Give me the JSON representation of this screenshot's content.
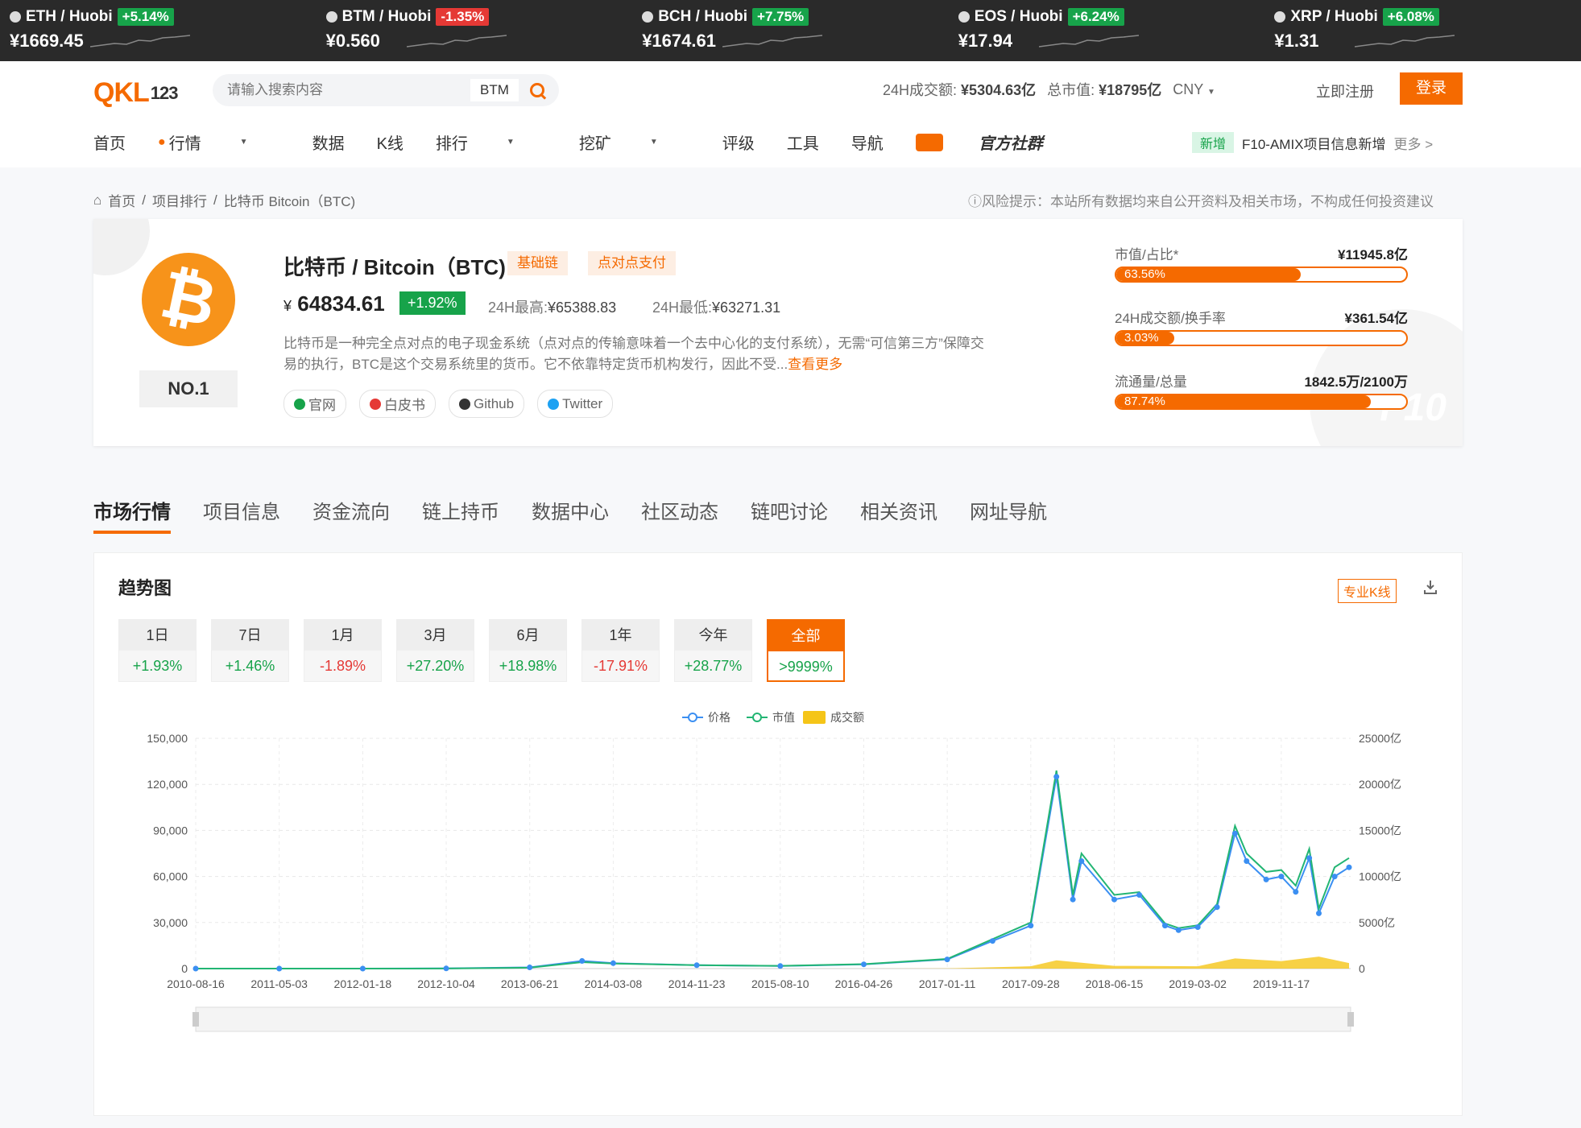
{
  "tickers": [
    {
      "pair": "ETH / Huobi",
      "change": "+5.14%",
      "dir": "up",
      "price": "¥1669.45"
    },
    {
      "pair": "BTM / Huobi",
      "change": "-1.35%",
      "dir": "down",
      "price": "¥0.560"
    },
    {
      "pair": "BCH / Huobi",
      "change": "+7.75%",
      "dir": "up",
      "price": "¥1674.61"
    },
    {
      "pair": "EOS / Huobi",
      "change": "+6.24%",
      "dir": "up",
      "price": "¥17.94"
    },
    {
      "pair": "XRP / Huobi",
      "change": "+6.08%",
      "dir": "up",
      "price": "¥1.31"
    }
  ],
  "header": {
    "logo_main": "QKL",
    "logo_sub": "123",
    "search_placeholder": "请输入搜索内容",
    "search_tag": "BTM",
    "vol_label": "24H成交额:",
    "vol_value": "¥5304.63亿",
    "cap_label": "总市值:",
    "cap_value": "¥18795亿",
    "currency": "CNY",
    "register": "立即注册",
    "login": "登录"
  },
  "nav": {
    "items": [
      "首页",
      "行情",
      "数据",
      "K线",
      "排行",
      "挖矿",
      "评级",
      "工具",
      "导航"
    ],
    "community": "官方社群",
    "news_badge": "新增",
    "news_text": "F10-AMIX项目信息新增",
    "news_more": "更多 >"
  },
  "breadcrumb": {
    "home": "首页",
    "rank": "项目排行",
    "current": "比特币 Bitcoin（BTC)",
    "risk": "ⓘ风险提示：本站所有数据均来自公开资料及相关市场，不构成任何投资建议"
  },
  "coin": {
    "symbol_glyph": "₿",
    "rank": "NO.1",
    "name": "比特币 / Bitcoin（BTC)",
    "tag1": "基础链",
    "tag2": "点对点支付",
    "currency_sign": "¥",
    "price": "64834.61",
    "change": "+1.92%",
    "high_label": "24H最高:",
    "high": "¥65388.83",
    "low_label": "24H最低:",
    "low": "¥63271.31",
    "description": "比特币是一种完全点对点的电子现金系统（点对点的传输意味着一个去中心化的支付系统），无需“可信第三方”保障交易的执行，BTC是这个交易系统里的货币。它不依靠特定货币机构发行，因此不受...",
    "more": "查看更多",
    "links": [
      "官网",
      "白皮书",
      "Github",
      "Twitter"
    ],
    "metrics": [
      {
        "label": "市值/占比*",
        "value": "¥11945.8亿",
        "pct": "63.56%",
        "fill": 0.6356
      },
      {
        "label": "24H成交额/换手率",
        "value": "¥361.54亿",
        "pct": "3.03%",
        "fill": 0.2
      },
      {
        "label": "流通量/总量",
        "value": "1842.5万/2100万",
        "pct": "87.74%",
        "fill": 0.8774
      }
    ],
    "watermark": "F10"
  },
  "tabs": [
    "市场行情",
    "项目信息",
    "资金流向",
    "链上持币",
    "数据中心",
    "社区动态",
    "链吧讨论",
    "相关资讯",
    "网址导航"
  ],
  "panel": {
    "title": "趋势图",
    "pro_k": "专业K线",
    "periods": [
      {
        "label": "1日",
        "value": "+1.93%",
        "dir": "up"
      },
      {
        "label": "7日",
        "value": "+1.46%",
        "dir": "up"
      },
      {
        "label": "1月",
        "value": "-1.89%",
        "dir": "down"
      },
      {
        "label": "3月",
        "value": "+27.20%",
        "dir": "up"
      },
      {
        "label": "6月",
        "value": "+18.98%",
        "dir": "up"
      },
      {
        "label": "1年",
        "value": "-17.91%",
        "dir": "down"
      },
      {
        "label": "今年",
        "value": "+28.77%",
        "dir": "up"
      },
      {
        "label": "全部",
        "value": ">9999%",
        "dir": "up",
        "active": true
      }
    ]
  },
  "chart_data": {
    "type": "line",
    "legend": [
      "价格",
      "市值",
      "成交额"
    ],
    "legend_position": "top-center",
    "colors": {
      "price": "#3b8ff2",
      "market_cap": "#22b573",
      "volume": "#f5c518"
    },
    "x_ticks": [
      "2010-08-16",
      "2011-05-03",
      "2012-01-18",
      "2012-10-04",
      "2013-06-21",
      "2014-03-08",
      "2014-11-23",
      "2015-08-10",
      "2016-04-26",
      "2017-01-11",
      "2017-09-28",
      "2018-06-15",
      "2019-03-02",
      "2019-11-17"
    ],
    "y_left_ticks": [
      "0",
      "30,000",
      "60,000",
      "90,000",
      "120,000",
      "150,000"
    ],
    "y_left_range": [
      0,
      150000
    ],
    "y_right_ticks": [
      "0",
      "5000亿",
      "10000亿",
      "15000亿",
      "20000亿",
      "25000亿"
    ],
    "y_right_range": [
      0,
      25000
    ],
    "grid": true,
    "price_series": [
      [
        "2010-08-16",
        0
      ],
      [
        "2011-05-03",
        0
      ],
      [
        "2012-01-18",
        0
      ],
      [
        "2012-10-04",
        100
      ],
      [
        "2013-06-21",
        800
      ],
      [
        "2013-12-01",
        5000
      ],
      [
        "2014-03-08",
        3500
      ],
      [
        "2014-11-23",
        2200
      ],
      [
        "2015-08-10",
        1700
      ],
      [
        "2016-04-26",
        2800
      ],
      [
        "2017-01-11",
        6000
      ],
      [
        "2017-06-01",
        18000
      ],
      [
        "2017-09-28",
        28000
      ],
      [
        "2017-12-17",
        125000
      ],
      [
        "2018-02-06",
        45000
      ],
      [
        "2018-03-05",
        70000
      ],
      [
        "2018-06-15",
        45000
      ],
      [
        "2018-09-01",
        48000
      ],
      [
        "2018-11-20",
        28000
      ],
      [
        "2019-01-01",
        25000
      ],
      [
        "2019-03-02",
        27000
      ],
      [
        "2019-05-01",
        40000
      ],
      [
        "2019-06-26",
        88000
      ],
      [
        "2019-08-01",
        70000
      ],
      [
        "2019-10-01",
        58000
      ],
      [
        "2019-11-17",
        60000
      ],
      [
        "2020-01-01",
        50000
      ],
      [
        "2020-02-12",
        72000
      ],
      [
        "2020-03-13",
        36000
      ],
      [
        "2020-05-01",
        60000
      ],
      [
        "2020-06-15",
        66000
      ]
    ],
    "market_cap_series": [
      [
        "2010-08-16",
        0
      ],
      [
        "2011-05-03",
        0
      ],
      [
        "2012-01-18",
        0
      ],
      [
        "2012-10-04",
        10
      ],
      [
        "2013-06-21",
        100
      ],
      [
        "2013-12-01",
        700
      ],
      [
        "2014-03-08",
        550
      ],
      [
        "2014-11-23",
        370
      ],
      [
        "2015-08-10",
        300
      ],
      [
        "2016-04-26",
        480
      ],
      [
        "2017-01-11",
        1050
      ],
      [
        "2017-06-01",
        3200
      ],
      [
        "2017-09-28",
        5000
      ],
      [
        "2017-12-17",
        21500
      ],
      [
        "2018-02-06",
        8000
      ],
      [
        "2018-03-05",
        12500
      ],
      [
        "2018-06-15",
        8000
      ],
      [
        "2018-09-01",
        8300
      ],
      [
        "2018-11-20",
        4900
      ],
      [
        "2019-01-01",
        4400
      ],
      [
        "2019-03-02",
        4700
      ],
      [
        "2019-05-01",
        7000
      ],
      [
        "2019-06-26",
        15500
      ],
      [
        "2019-08-01",
        12500
      ],
      [
        "2019-10-01",
        10500
      ],
      [
        "2019-11-17",
        10700
      ],
      [
        "2020-01-01",
        9000
      ],
      [
        "2020-02-12",
        13000
      ],
      [
        "2020-03-13",
        6500
      ],
      [
        "2020-05-01",
        11000
      ],
      [
        "2020-06-15",
        12000
      ]
    ],
    "volume_series": [
      [
        "2010-08-16",
        0
      ],
      [
        "2016-04-26",
        0
      ],
      [
        "2017-01-11",
        20
      ],
      [
        "2017-09-28",
        250
      ],
      [
        "2017-12-17",
        900
      ],
      [
        "2018-06-15",
        300
      ],
      [
        "2019-03-02",
        250
      ],
      [
        "2019-06-26",
        1100
      ],
      [
        "2019-11-17",
        800
      ],
      [
        "2020-03-13",
        1300
      ],
      [
        "2020-06-15",
        600
      ]
    ]
  }
}
